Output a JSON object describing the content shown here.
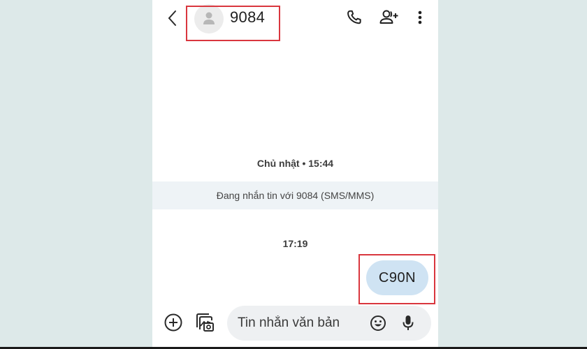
{
  "header": {
    "contact_name": "9084",
    "back_label": "Back",
    "actions": [
      {
        "icon": "phone-icon",
        "label": "Call"
      },
      {
        "icon": "add-person-icon",
        "label": "Add contact"
      },
      {
        "icon": "more-vert-icon",
        "label": "More options"
      }
    ]
  },
  "conversation": {
    "date_separator": "Chủ nhật • 15:44",
    "info_banner": "Đang nhắn tin với 9084 (SMS/MMS)",
    "time_separator": "17:19",
    "messages": [
      {
        "direction": "outgoing",
        "text": "C90N"
      }
    ]
  },
  "composer": {
    "placeholder": "Tin nhắn văn bản",
    "value": ""
  },
  "colors": {
    "background": "#dde9e9",
    "bubble": "#cfe3f3",
    "highlight": "#d9363e",
    "info_strip": "#eef3f6"
  }
}
